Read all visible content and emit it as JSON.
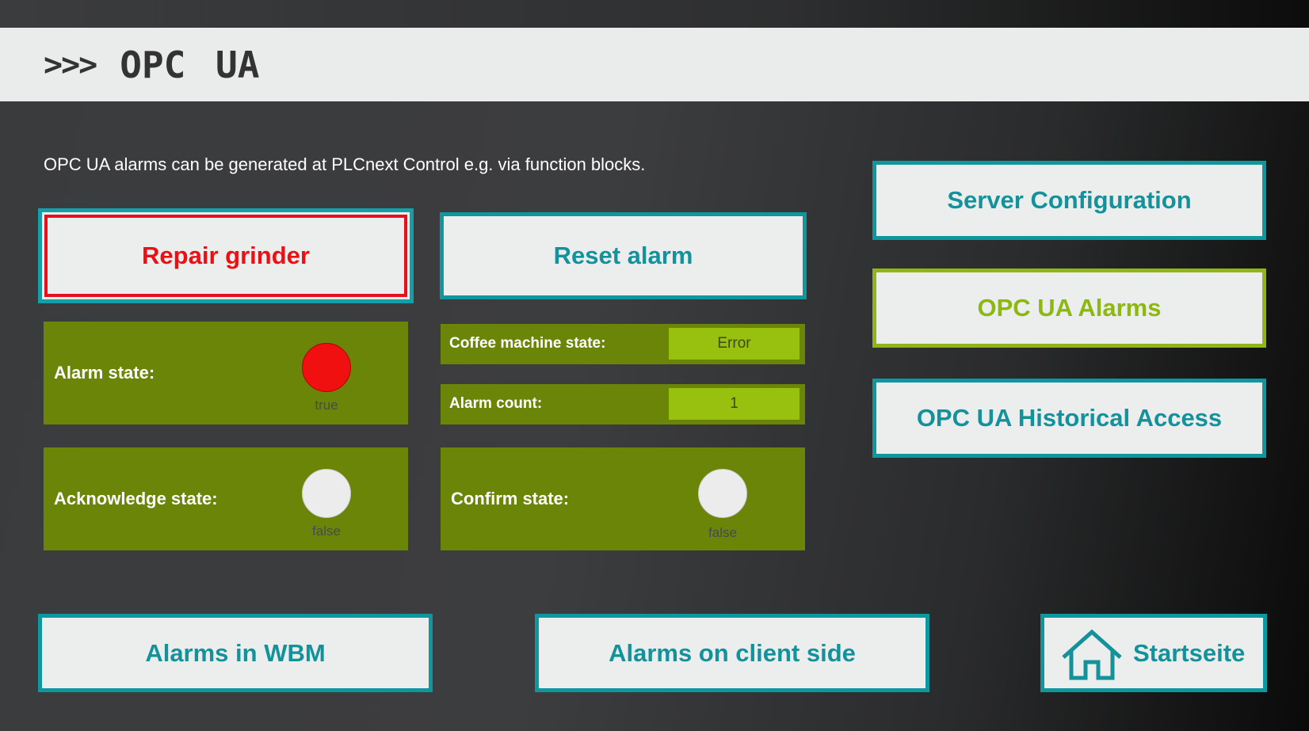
{
  "header": {
    "chevrons": ">>>",
    "title": "OPC UA"
  },
  "intro_text": "OPC UA alarms can be generated at PLCnext Control e.g. via function blocks.",
  "actions": {
    "repair_grinder": "Repair grinder",
    "reset_alarm": "Reset alarm"
  },
  "status": {
    "alarm_state": {
      "label": "Alarm state:",
      "value": "true"
    },
    "acknowledge_state": {
      "label": "Acknowledge state:",
      "value": "false"
    },
    "coffee_machine_state": {
      "label": "Coffee machine state:",
      "value": "Error"
    },
    "alarm_count": {
      "label": "Alarm count:",
      "value": "1"
    },
    "confirm_state": {
      "label": "Confirm state:",
      "value": "false"
    }
  },
  "nav": {
    "server_configuration": "Server Configuration",
    "opc_ua_alarms": "OPC UA Alarms",
    "opc_ua_historical_access": "OPC UA Historical Access",
    "alarms_in_wbm": "Alarms in WBM",
    "alarms_on_client_side": "Alarms on client side",
    "startseite": "Startseite"
  },
  "colors": {
    "accent_teal": "#0f97a0",
    "accent_green": "#8fb516",
    "panel_green": "#6a8507",
    "alarm_red": "#f01010"
  },
  "icons": {
    "home": "home-icon"
  }
}
